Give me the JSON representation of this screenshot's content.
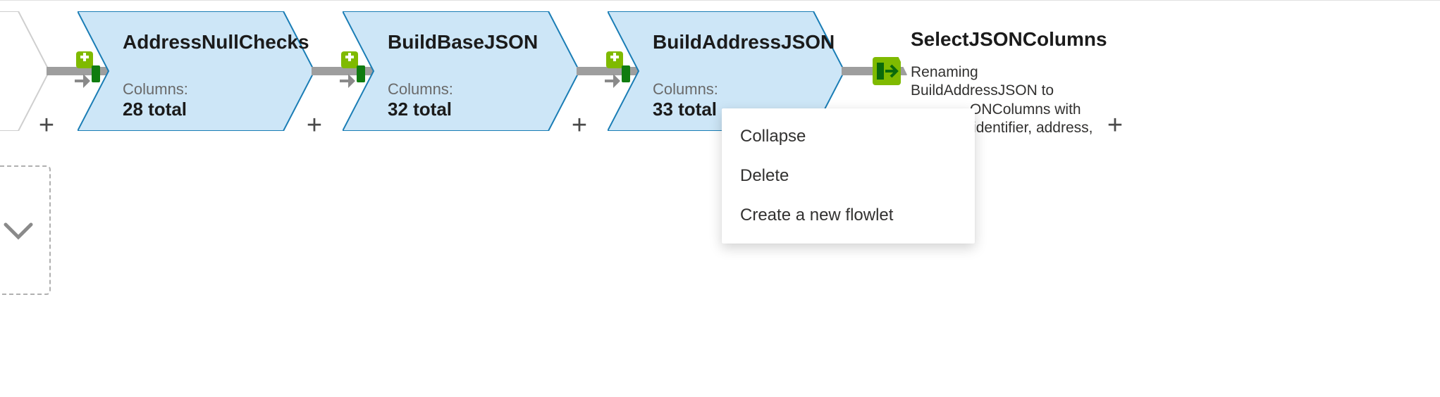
{
  "colors": {
    "nodeFill": "#cde6f7",
    "nodeStroke": "#1a7db5",
    "selectFill": "#ffffff",
    "selectStroke": "#ffffff",
    "stubFill": "#ffffff",
    "stubStroke": "#cfcfcf",
    "connector": "#9e9e9e"
  },
  "nodes": [
    {
      "id": "addressNullChecks",
      "title": "AddressNullChecks",
      "columns_label": "Columns:",
      "columns_value": "28 total"
    },
    {
      "id": "buildBaseJSON",
      "title": "BuildBaseJSON",
      "columns_label": "Columns:",
      "columns_value": "32 total"
    },
    {
      "id": "buildAddressJSON",
      "title": "BuildAddressJSON",
      "columns_label": "Columns:",
      "columns_value": "33 total"
    }
  ],
  "select_node": {
    "title": "SelectJSONColumns",
    "description_line1": "Renaming",
    "description_line2": "BuildAddressJSON to",
    "description_line3": "ONColumns with",
    "description_line4": "'identifier, address,"
  },
  "add_label": "+",
  "context_menu": {
    "items": [
      {
        "id": "collapse",
        "label": "Collapse"
      },
      {
        "id": "delete",
        "label": "Delete"
      },
      {
        "id": "flowlet",
        "label": "Create a new flowlet"
      }
    ]
  }
}
